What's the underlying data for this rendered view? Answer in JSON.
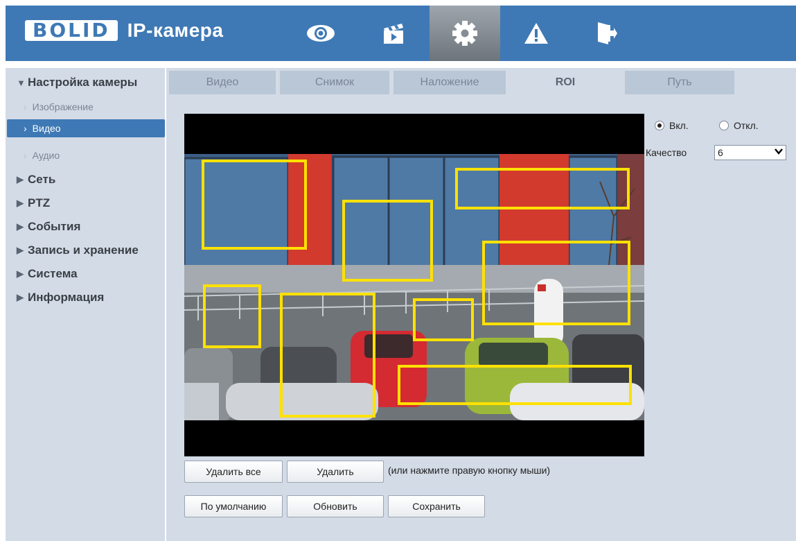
{
  "header": {
    "logo_text": "BOLID",
    "title": "IP-камера",
    "nav": [
      {
        "icon": "eye-icon",
        "label": ""
      },
      {
        "icon": "clapperboard-icon",
        "label": ""
      },
      {
        "icon": "gear-icon",
        "label": ""
      },
      {
        "icon": "warning-icon",
        "label": ""
      },
      {
        "icon": "logout-icon",
        "label": ""
      }
    ],
    "active_nav": "gear-icon"
  },
  "sidebar": {
    "section_open": "Настройка камеры",
    "sub_items": [
      "Изображение",
      "Видео",
      "Аудио"
    ],
    "active_sub": "Видео",
    "sections": [
      "Сеть",
      "PTZ",
      "События",
      "Запись и хранение",
      "Система",
      "Информация"
    ]
  },
  "tabs": [
    "Видео",
    "Снимок",
    "Наложение",
    "ROI",
    "Путь"
  ],
  "active_tab": "ROI",
  "roi": {
    "on_label": "Вкл.",
    "off_label": "Откл.",
    "state": "on",
    "quality_label": "Качество",
    "quality_value": "6"
  },
  "buttons": {
    "delete_all": "Удалить все",
    "delete": "Удалить",
    "hint": "(или нажмите правую кнопку мыши)",
    "default": "По умолчанию",
    "refresh": "Обновить",
    "save": "Сохранить"
  },
  "colors": {
    "header_bg": "#3f79b5",
    "panel_bg": "#d3dbe6",
    "roi_box": "#ffe100",
    "active_item": "#3f79b5"
  }
}
